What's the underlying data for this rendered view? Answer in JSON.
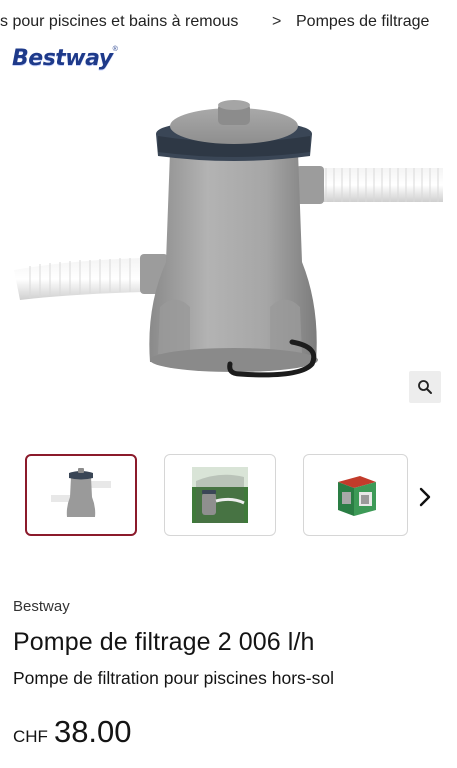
{
  "breadcrumb": {
    "items": [
      "s pour piscines et bains à remous",
      "Pompes de filtrage"
    ],
    "separator": ">"
  },
  "brand": {
    "logo_text": "Bestway",
    "logo_mark": "®"
  },
  "gallery": {
    "main_image": "filter-pump-photo",
    "zoom_icon": "search-icon",
    "next_icon": "chevron-right-icon",
    "thumbnails": [
      "filter-pump-thumbnail",
      "pool-installation-thumbnail",
      "product-box-thumbnail"
    ],
    "active_index": 0,
    "active_border_color": "#8b1a2b"
  },
  "product": {
    "vendor": "Bestway",
    "title": "Pompe de filtrage 2 006 l/h",
    "subtitle": "Pompe de filtration pour piscines hors-sol",
    "currency": "CHF",
    "price": "38.00"
  }
}
